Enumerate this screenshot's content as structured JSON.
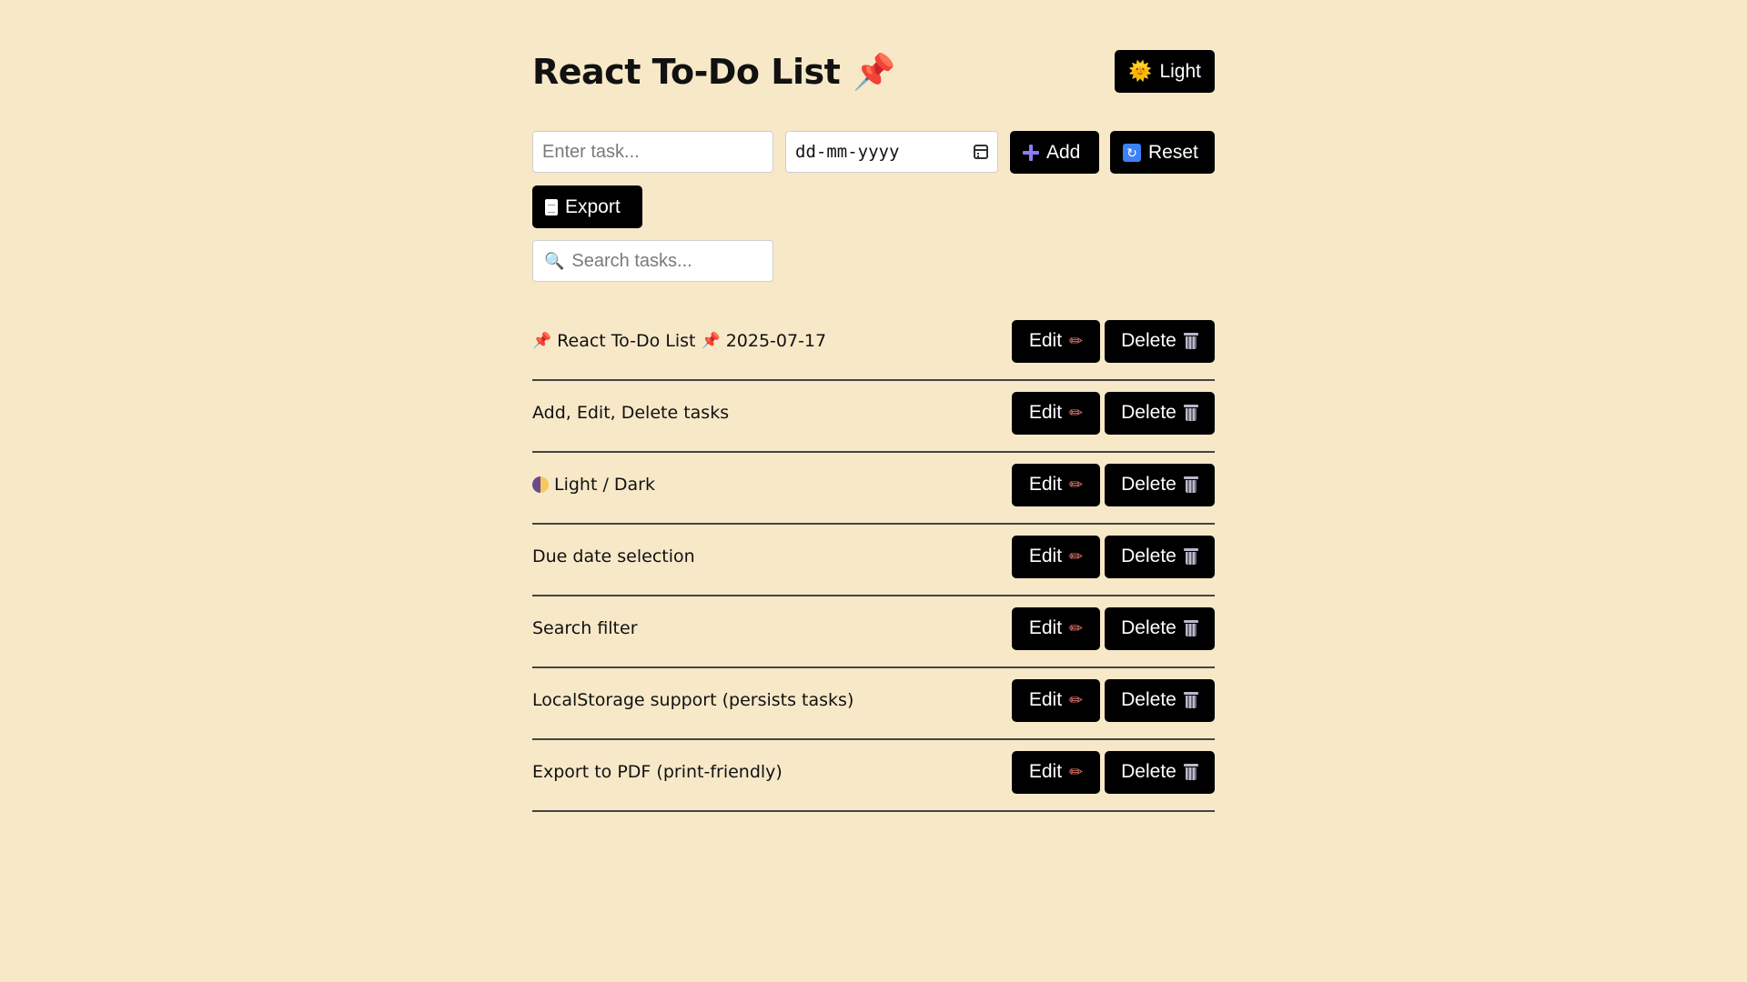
{
  "header": {
    "title": "React To-Do List",
    "title_icon": "pushpin-icon",
    "theme_button_label": "Light",
    "theme_button_icon": "sun-icon"
  },
  "controls": {
    "task_input_placeholder": "Enter task...",
    "task_input_value": "",
    "date_input_value": "dd-mm-yyyy",
    "add_label": "Add",
    "reset_label": "Reset",
    "export_label": "Export"
  },
  "search": {
    "placeholder": "Search tasks...",
    "value": ""
  },
  "tasks": [
    {
      "text": "React To-Do List",
      "prefix_icon": "pushpin-icon",
      "suffix_icon": "pushpin-icon",
      "due": "2025-07-17"
    },
    {
      "text": "Add, Edit, Delete tasks",
      "due": ""
    },
    {
      "text": "Light / Dark",
      "prefix_icon": "half-moon-icon",
      "due": ""
    },
    {
      "text": "Due date selection",
      "due": ""
    },
    {
      "text": "Search filter",
      "due": ""
    },
    {
      "text": "LocalStorage support (persists tasks)",
      "due": ""
    },
    {
      "text": "Export to PDF (print-friendly)",
      "due": ""
    }
  ],
  "row_actions": {
    "edit_label": "Edit",
    "delete_label": "Delete"
  },
  "colors": {
    "background": "#f7e8c8",
    "button_bg": "#000000",
    "button_text": "#ffffff",
    "divider": "#444444"
  }
}
